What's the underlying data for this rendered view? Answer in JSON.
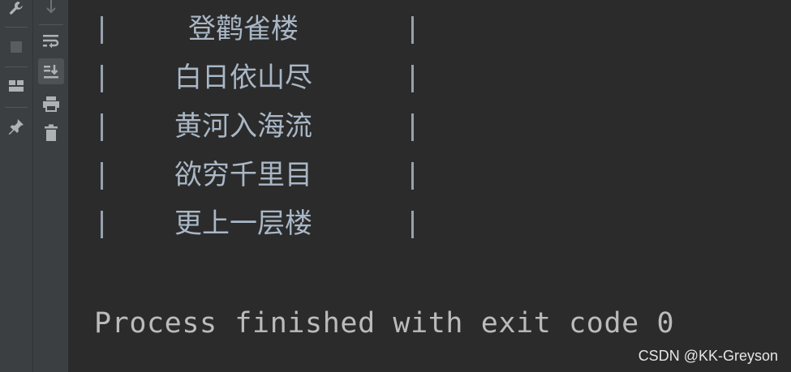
{
  "toolbar_left": {
    "icons": [
      "wrench-icon",
      "stop-icon",
      "layout-icon",
      "pin-icon"
    ]
  },
  "toolbar_second": {
    "icons": [
      "scroll-down-icon",
      "soft-wrap-icon",
      "scroll-to-end-icon",
      "print-icon",
      "trash-icon"
    ]
  },
  "console": {
    "poem_lines": [
      "登鹳雀楼",
      "白日依山尽",
      "黄河入海流",
      "欲穷千里目",
      "更上一层楼"
    ],
    "separator": "|",
    "process_message": "Process finished with exit code 0"
  },
  "watermark": "CSDN @KK-Greyson",
  "colors": {
    "background": "#2b2b2b",
    "toolbar": "#3c3f41",
    "console_text": "#a9b7c6",
    "process_text": "#bbbbbb"
  }
}
